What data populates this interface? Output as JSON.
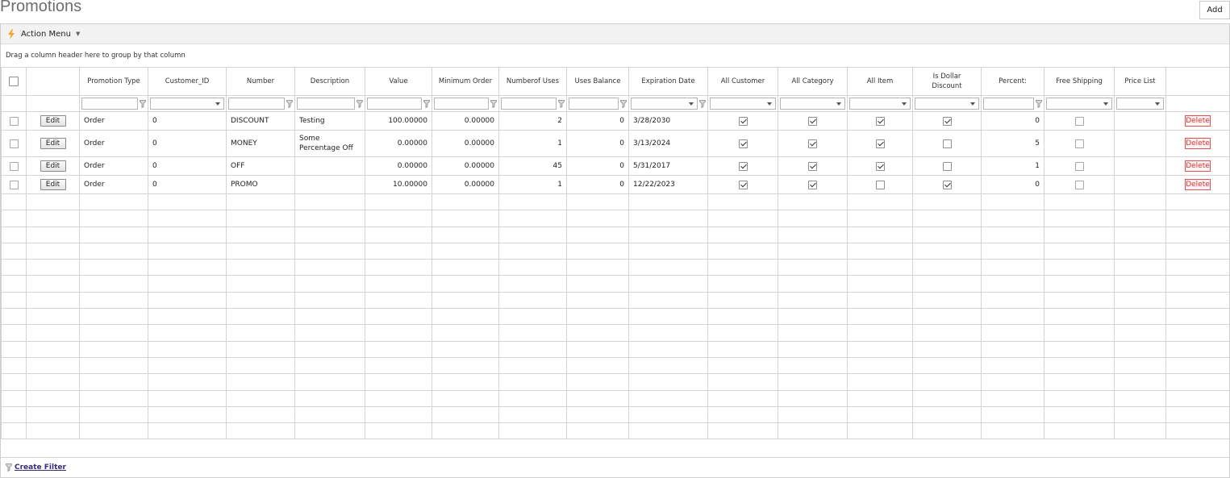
{
  "page": {
    "title": "Promotions",
    "add_label": "Add"
  },
  "toolbar": {
    "action_menu_label": "Action Menu"
  },
  "grid": {
    "group_panel_text": "Drag a column header here to group by that column",
    "columns": {
      "promotion_type": "Promotion Type",
      "customer_id": "Customer_ID",
      "number": "Number",
      "description": "Description",
      "value": "Value",
      "minimum_order": "Minimum Order",
      "number_of_uses": "Numberof Uses",
      "uses_balance": "Uses Balance",
      "expiration_date": "Expiration Date",
      "all_customer": "All Customer",
      "all_category": "All Category",
      "all_item": "All Item",
      "is_dollar_discount": "Is Dollar Discount",
      "percent": "Percent:",
      "free_shipping": "Free Shipping",
      "price_list": "Price List"
    },
    "edit_label": "Edit",
    "delete_label": "Delete",
    "rows": [
      {
        "promotion_type": "Order",
        "customer_id": "0",
        "number": "DISCOUNT",
        "description": "Testing",
        "value": "100.00000",
        "minimum_order": "0.00000",
        "number_of_uses": "2",
        "uses_balance": "0",
        "expiration_date": "3/28/2030",
        "all_customer": true,
        "all_category": true,
        "all_item": true,
        "is_dollar_discount": true,
        "percent": "0",
        "free_shipping": false
      },
      {
        "promotion_type": "Order",
        "customer_id": "0",
        "number": "MONEY",
        "description": "Some Percentage Off",
        "value": "0.00000",
        "minimum_order": "0.00000",
        "number_of_uses": "1",
        "uses_balance": "0",
        "expiration_date": "3/13/2024",
        "all_customer": true,
        "all_category": true,
        "all_item": true,
        "is_dollar_discount": false,
        "percent": "5",
        "free_shipping": false
      },
      {
        "promotion_type": "Order",
        "customer_id": "0",
        "number": "OFF",
        "description": "",
        "value": "0.00000",
        "minimum_order": "0.00000",
        "number_of_uses": "45",
        "uses_balance": "0",
        "expiration_date": "5/31/2017",
        "all_customer": true,
        "all_category": true,
        "all_item": true,
        "is_dollar_discount": false,
        "percent": "1",
        "free_shipping": false
      },
      {
        "promotion_type": "Order",
        "customer_id": "0",
        "number": "PROMO",
        "description": "",
        "value": "10.00000",
        "minimum_order": "0.00000",
        "number_of_uses": "1",
        "uses_balance": "0",
        "expiration_date": "12/22/2023",
        "all_customer": true,
        "all_category": true,
        "all_item": false,
        "is_dollar_discount": true,
        "percent": "0",
        "free_shipping": false
      }
    ]
  },
  "footer": {
    "create_filter_label": "Create Filter"
  },
  "colors": {
    "accent_bolt": "#f5a623",
    "delete_red": "#e23030",
    "link_purple": "#3a2a7a"
  }
}
